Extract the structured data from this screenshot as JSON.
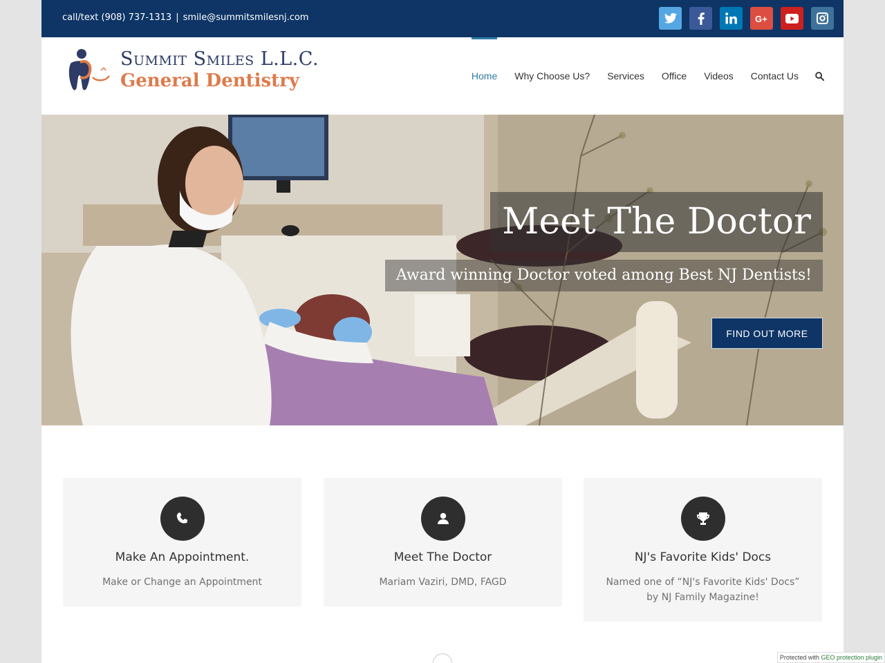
{
  "topbar": {
    "phone_text": "call/text (908) 737-1313",
    "separator": "|",
    "email_text": "smile@summitsmilesnj.com",
    "socials": [
      {
        "name": "twitter-icon",
        "glyph": "twitter",
        "color": "#54a7e2"
      },
      {
        "name": "facebook-icon",
        "glyph": "f",
        "color": "#3b5998"
      },
      {
        "name": "linkedin-icon",
        "glyph": "in",
        "color": "#0077b5"
      },
      {
        "name": "google-plus-icon",
        "glyph": "G+",
        "color": "#dc4e41"
      },
      {
        "name": "youtube-icon",
        "glyph": "play",
        "color": "#cd201f"
      },
      {
        "name": "instagram-icon",
        "glyph": "camera",
        "color": "#3f729b"
      }
    ]
  },
  "header": {
    "logo_line1": "Summit Smiles L.L.C.",
    "logo_line2": "General Dentistry",
    "nav": [
      "Home",
      "Why Choose Us?",
      "Services",
      "Office",
      "Videos",
      "Contact Us"
    ],
    "active_nav": "Home",
    "search_icon": "search-icon"
  },
  "hero": {
    "title": "Meet The Doctor",
    "subtitle": "Award winning Doctor voted among Best NJ Dentists!",
    "button": "FIND OUT MORE"
  },
  "cards": [
    {
      "icon": "phone-icon",
      "title": "Make An Appointment.",
      "text": "Make or Change an Appointment"
    },
    {
      "icon": "user-icon",
      "title": "Meet The Doctor",
      "text": "Mariam Vaziri, DMD, FAGD"
    },
    {
      "icon": "trophy-icon",
      "title": "NJ's Favorite Kids' Docs",
      "text": "Named one of “NJ's Favorite Kids' Docs” by NJ Family Magazine!"
    }
  ],
  "geo_badge": {
    "prefix": "Protected with",
    "link": "GEO protection plugin"
  },
  "colors": {
    "topbar": "#0e3566",
    "accent": "#2f7ca6",
    "logo_navy": "#2d3b66",
    "logo_orange": "#de7a4a"
  }
}
